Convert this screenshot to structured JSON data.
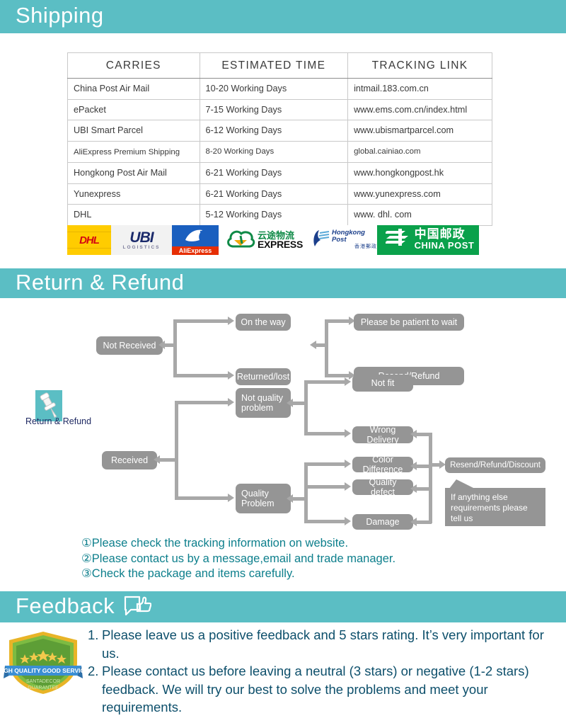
{
  "sections": {
    "shipping": {
      "title": "Shipping"
    },
    "return": {
      "title": "Return & Refund"
    },
    "feedback": {
      "title": "Feedback",
      "icon": "thumbs-up-speech-bubble-icon"
    }
  },
  "shipping_table": {
    "headers": [
      "CARRIES",
      "ESTIMATED TIME",
      "TRACKING LINK"
    ],
    "rows": [
      [
        "China Post Air Mail",
        "10-20 Working Days",
        "intmail.183.com.cn"
      ],
      [
        "ePacket",
        "7-15 Working Days",
        "www.ems.com.cn/index.html"
      ],
      [
        "UBI Smart Parcel",
        "6-12 Working Days",
        "www.ubismartparcel.com"
      ],
      [
        "AliExpress Premium Shipping",
        "8-20 Working Days",
        "global.cainiao.com"
      ],
      [
        "Hongkong Post Air Mail",
        "6-21 Working Days",
        "www.hongkongpost.hk"
      ],
      [
        "Yunexpress",
        "6-21 Working Days",
        "www.yunexpress.com"
      ],
      [
        "DHL",
        "5-12 Working Days",
        "www. dhl. com"
      ]
    ]
  },
  "logos": {
    "dhl": {
      "name": "dhl-logo",
      "text": "DHL"
    },
    "ubi": {
      "name": "ubi-logo",
      "text": "UBI",
      "sub": "LOGISTICS"
    },
    "aliexpress": {
      "name": "aliexpress-logo",
      "text": "AliExpress"
    },
    "yunexpress": {
      "name": "yunexpress-logo",
      "cn": "云途物流",
      "en": "EXPRESS"
    },
    "hongkongpost": {
      "name": "hongkong-post-logo",
      "en": "Hongkong Post",
      "cn": "香港郵政"
    },
    "chinapost": {
      "name": "china-post-logo",
      "cn": "中国邮政",
      "en": "CHINA POST"
    }
  },
  "flowchart": {
    "badge_label": "Return & Refund",
    "badge_icon": "push-pin-icon",
    "nodes": {
      "not_received": "Not Received",
      "on_the_way": "On the way",
      "returned_lost": "Returned/lost",
      "please_wait": "Please be patient to wait",
      "resend_refund": "Resend/Refund",
      "received": "Received",
      "not_quality_problem": "Not quality\nproblem",
      "not_quality_problem_l1": "Not quality",
      "not_quality_problem_l2": "problem",
      "quality_problem_l1": "Quality",
      "quality_problem_l2": "Problem",
      "not_fit": "Not fit",
      "wrong_delivery": "Wrong Delivery",
      "color_difference": "Color Difference",
      "quality_defect": "Quality defect",
      "damage": "Damage",
      "resend_refund_discount": "Resend/Refund/Discount"
    },
    "callout": "If anything else requirements please tell us"
  },
  "notes": [
    "①Please check the tracking information on website.",
    "②Please contact us by a message,email and trade manager.",
    "③Check the package and items carefully."
  ],
  "feedback_items": [
    {
      "num": "1.",
      "text": "Please leave us a positive feedback and 5 stars rating. It’s very important for us."
    },
    {
      "num": "2.",
      "text": "Please contact us before leaving a neutral (3 stars) or negative (1-2 stars) feedback. We will try our best to solve the problems and meet your requirements."
    }
  ],
  "quality_badge": {
    "name": "quality-guarantee-badge",
    "banner": "HIGH QUALITY GOOD SERVICE",
    "line1": "SANTADECOR",
    "line2": "GUARANTEE"
  },
  "colors": {
    "teal": "#5bbec4",
    "note_text": "#0d7f8c",
    "feedback_text": "#0d4f6b",
    "node_gray": "#959595",
    "line_gray": "#a8a8a8"
  }
}
